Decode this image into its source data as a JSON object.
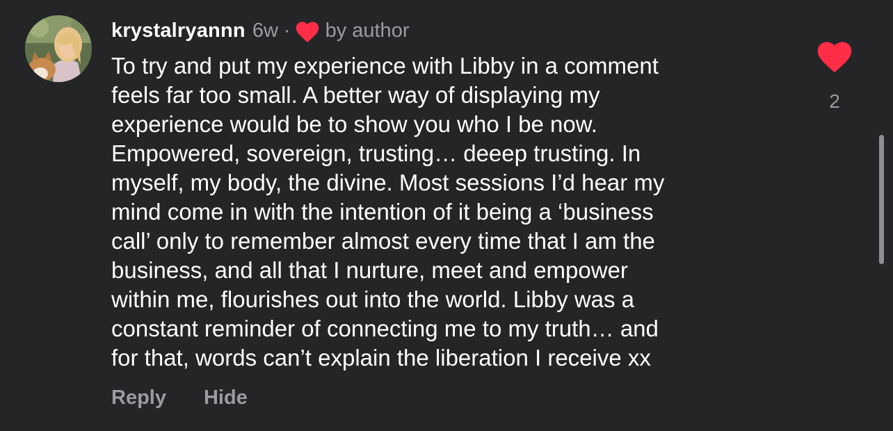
{
  "comment": {
    "username": "krystalryannn",
    "timestamp": "6w",
    "separator": "·",
    "author_like_label": "by author",
    "body_lines": [
      "To try and put my experience with Libby in a comment",
      "feels far too small. A better way of displaying my",
      "experience would be to show you who I be now.",
      "Empowered, sovereign, trusting… deeep trusting. In",
      "myself, my body, the divine. Most sessions I’d hear my",
      "mind come in with the intention of it being a ‘business",
      "call’ only to remember almost every time that I am the",
      "business, and all that I nurture, meet and empower",
      "within me, flourishes out into the world. Libby was a",
      "constant reminder of connecting me to my truth… and",
      "for that, words can’t explain the liberation I receive xx"
    ],
    "actions": {
      "reply": "Reply",
      "hide": "Hide"
    },
    "like_count": "2"
  },
  "icons": {
    "author_like": "heart-icon",
    "like": "heart-icon"
  },
  "colors": {
    "background": "#242527",
    "heart": "#ff2d46",
    "muted_text": "#9a9ca2"
  }
}
